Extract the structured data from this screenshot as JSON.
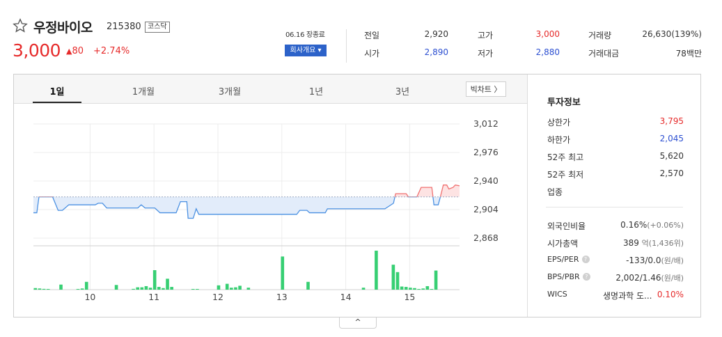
{
  "stock": {
    "name": "우정바이오",
    "code": "215380",
    "market": "코스닥",
    "price": "3,000",
    "change": "80",
    "change_arrow": "▲",
    "rate": "+2.74%",
    "date": "06.16 장종료",
    "company_button": "회사개요 ▾"
  },
  "quote": {
    "prev_label": "전일",
    "prev": "2,920",
    "open_label": "시가",
    "open": "2,890",
    "high_label": "고가",
    "high": "3,000",
    "low_label": "저가",
    "low": "2,880",
    "volume_label": "거래량",
    "volume": "26,630(139%)",
    "amount_label": "거래대금",
    "amount": "78백만"
  },
  "tabs": [
    {
      "label": "1일"
    },
    {
      "label": "1개월"
    },
    {
      "label": "3개월"
    },
    {
      "label": "1년"
    },
    {
      "label": "3년"
    }
  ],
  "bigchart_label": "빅차트 〉",
  "invest": {
    "title": "투자정보",
    "rows": [
      {
        "label": "상한가",
        "value": "3,795",
        "color": "#e62a2a"
      },
      {
        "label": "하한가",
        "value": "2,045",
        "color": "#2c4fd1"
      },
      {
        "label": "52주 최고",
        "value": "5,620"
      },
      {
        "label": "52주 최저",
        "value": "2,570"
      },
      {
        "label": "업종",
        "value": ""
      }
    ],
    "foreign_label": "외국인비율",
    "foreign_value": "0.16%",
    "foreign_change": "(+0.06%)",
    "mcap_label": "시가총액",
    "mcap_value": "389",
    "mcap_unit": "억(1,436위)",
    "eps_label": "EPS/PER",
    "eps_value": "-133/0.0",
    "eps_unit": "(원/배)",
    "bps_label": "BPS/PBR",
    "bps_value": "2,002/1.46",
    "bps_unit": "(원/배)",
    "wics_label": "WICS",
    "wics_value": "생명과학 도...",
    "wics_rate": "0.10%",
    "help_icon": "?"
  },
  "collapse_icon": "^",
  "chart_data": {
    "type": "line",
    "ylabels": [
      "3,012",
      "2,976",
      "2,940",
      "2,904",
      "2,868"
    ],
    "yticks": [
      3012,
      2976,
      2940,
      2904,
      2868
    ],
    "ylim": [
      2868,
      3012
    ],
    "baseline": 2920,
    "xlabels": [
      "10",
      "11",
      "12",
      "13",
      "14",
      "15"
    ],
    "xtick_positions": [
      0.133,
      0.283,
      0.433,
      0.583,
      0.733,
      0.883
    ],
    "price_series": [
      [
        0,
        2900
      ],
      [
        0.008,
        2900
      ],
      [
        0.013,
        2920
      ],
      [
        0.045,
        2920
      ],
      [
        0.058,
        2903
      ],
      [
        0.068,
        2903
      ],
      [
        0.083,
        2910
      ],
      [
        0.145,
        2910
      ],
      [
        0.152,
        2912
      ],
      [
        0.162,
        2912
      ],
      [
        0.172,
        2906
      ],
      [
        0.245,
        2906
      ],
      [
        0.253,
        2910
      ],
      [
        0.262,
        2906
      ],
      [
        0.285,
        2906
      ],
      [
        0.297,
        2900
      ],
      [
        0.335,
        2900
      ],
      [
        0.345,
        2914
      ],
      [
        0.36,
        2914
      ],
      [
        0.363,
        2893
      ],
      [
        0.375,
        2893
      ],
      [
        0.382,
        2905
      ],
      [
        0.388,
        2898
      ],
      [
        0.618,
        2898
      ],
      [
        0.625,
        2903
      ],
      [
        0.642,
        2903
      ],
      [
        0.648,
        2900
      ],
      [
        0.685,
        2900
      ],
      [
        0.69,
        2905
      ],
      [
        0.825,
        2905
      ],
      [
        0.845,
        2912
      ],
      [
        0.85,
        2924
      ],
      [
        0.875,
        2924
      ],
      [
        0.88,
        2920
      ],
      [
        0.9,
        2920
      ],
      [
        0.91,
        2932
      ],
      [
        0.935,
        2932
      ],
      [
        0.94,
        2910
      ],
      [
        0.95,
        2910
      ],
      [
        0.955,
        2920
      ],
      [
        0.962,
        2935
      ],
      [
        0.97,
        2935
      ],
      [
        0.975,
        2930
      ],
      [
        0.985,
        2932
      ],
      [
        0.99,
        2935
      ],
      [
        1.0,
        2934
      ]
    ],
    "volumes": [
      0.04,
      0.03,
      0.02,
      0.01,
      0.0,
      0.0,
      0.13,
      0.0,
      0.0,
      0.0,
      0.01,
      0.03,
      0.2,
      0.0,
      0.0,
      0.0,
      0.0,
      0.0,
      0.0,
      0.12,
      0.0,
      0.0,
      0.0,
      0.02,
      0.06,
      0.06,
      0.09,
      0.05,
      0.5,
      0.07,
      0.04,
      0.28,
      0.07,
      0.0,
      0.0,
      0.0,
      0.0,
      0.01,
      0.01,
      0.0,
      0.0,
      0.0,
      0.0,
      0.11,
      0.0,
      0.15,
      0.05,
      0.06,
      0.1,
      0.0,
      0.05,
      0.0,
      0.0,
      0.0,
      0.0,
      0.0,
      0.0,
      0.0,
      0.85,
      0.0,
      0.0,
      0.0,
      0.0,
      0.0,
      0.2,
      0.0,
      0.0,
      0.0,
      0.0,
      0.0,
      0.0,
      0.0,
      0.0,
      0.0,
      0.0,
      0.0,
      0.0,
      0.05,
      0.0,
      0.0,
      1.0,
      0.0,
      0.0,
      0.0,
      0.64,
      0.45,
      0.08,
      0.07,
      0.05,
      0.04,
      0.01,
      0.03,
      0.09,
      0.01,
      0.49,
      0.0,
      0.0,
      0.0,
      0.0,
      0.0
    ]
  }
}
